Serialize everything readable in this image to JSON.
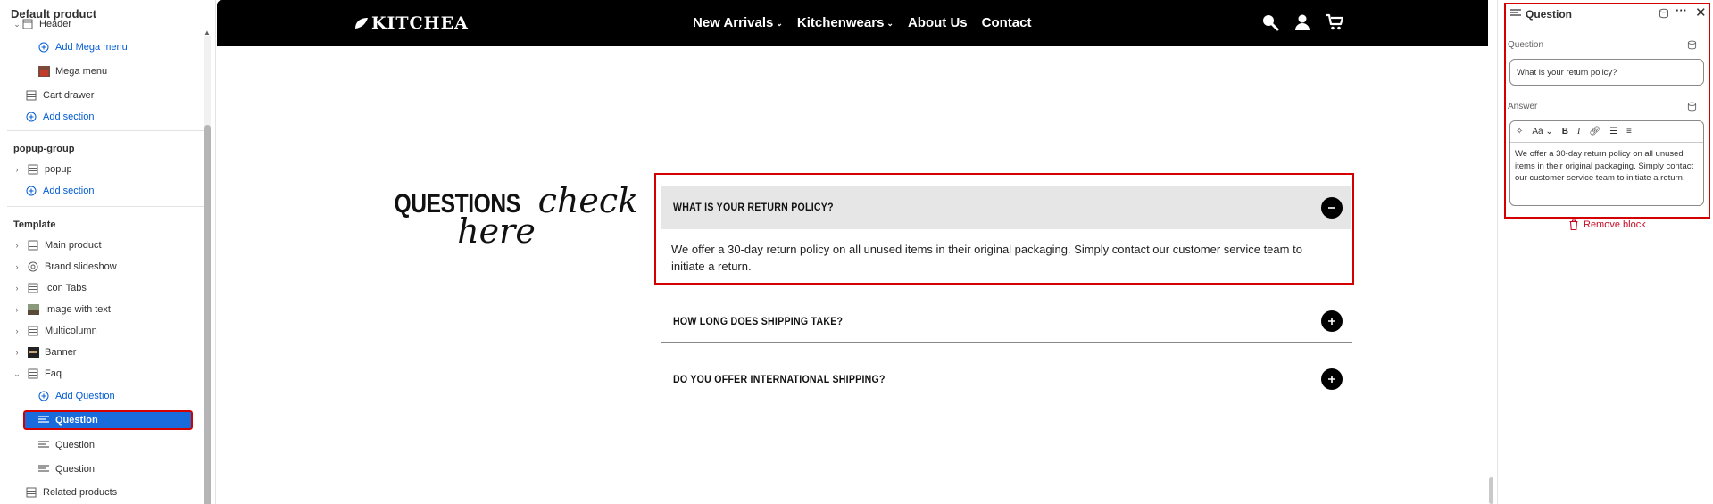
{
  "sidebar": {
    "title": "Default product",
    "items": [
      {
        "label": "Header",
        "type": "item"
      },
      {
        "label": "Add Mega menu",
        "type": "add"
      },
      {
        "label": "Mega menu",
        "type": "item"
      },
      {
        "label": "Cart drawer",
        "type": "item"
      },
      {
        "label": "Add section",
        "type": "add"
      },
      {
        "label": "popup-group",
        "type": "group"
      },
      {
        "label": "popup",
        "type": "item"
      },
      {
        "label": "Add section",
        "type": "add"
      },
      {
        "label": "Template",
        "type": "group"
      },
      {
        "label": "Main product",
        "type": "item"
      },
      {
        "label": "Brand slideshow",
        "type": "item"
      },
      {
        "label": "Icon Tabs",
        "type": "item"
      },
      {
        "label": "Image with text",
        "type": "item"
      },
      {
        "label": "Multicolumn",
        "type": "item"
      },
      {
        "label": "Banner",
        "type": "item"
      },
      {
        "label": "Faq",
        "type": "item"
      },
      {
        "label": "Add Question",
        "type": "add"
      },
      {
        "label": "Question",
        "type": "selected"
      },
      {
        "label": "Question",
        "type": "item"
      },
      {
        "label": "Question",
        "type": "item"
      },
      {
        "label": "Related products",
        "type": "item"
      }
    ]
  },
  "store": {
    "logo": "KITCHEA",
    "nav": [
      "New Arrivals",
      "Kitchenwears",
      "About Us",
      "Contact"
    ],
    "faq_heading_bold": "QUESTIONS",
    "faq_heading_script_1": "check",
    "faq_heading_script_2": "here",
    "questions": [
      {
        "q": "WHAT IS YOUR RETURN POLICY?",
        "a": "We offer a 30-day return policy on all unused items in their original packaging. Simply contact our customer service team to initiate a return.",
        "open": true
      },
      {
        "q": "HOW LONG DOES SHIPPING TAKE?",
        "open": false
      },
      {
        "q": "DO YOU OFFER INTERNATIONAL SHIPPING?",
        "open": false
      }
    ]
  },
  "panel": {
    "title": "Question",
    "question_label": "Question",
    "question_value": "What is your return policy?",
    "answer_label": "Answer",
    "answer_value": "We offer a 30-day return policy on all unused items in their original packaging. Simply contact our customer service team to initiate a return.",
    "toolbar_font": "Aa",
    "remove_label": "Remove block"
  },
  "colors": {
    "accent": "#1a6cdd",
    "highlight": "#d40000",
    "link": "#005bd3",
    "danger": "#c70a24"
  }
}
